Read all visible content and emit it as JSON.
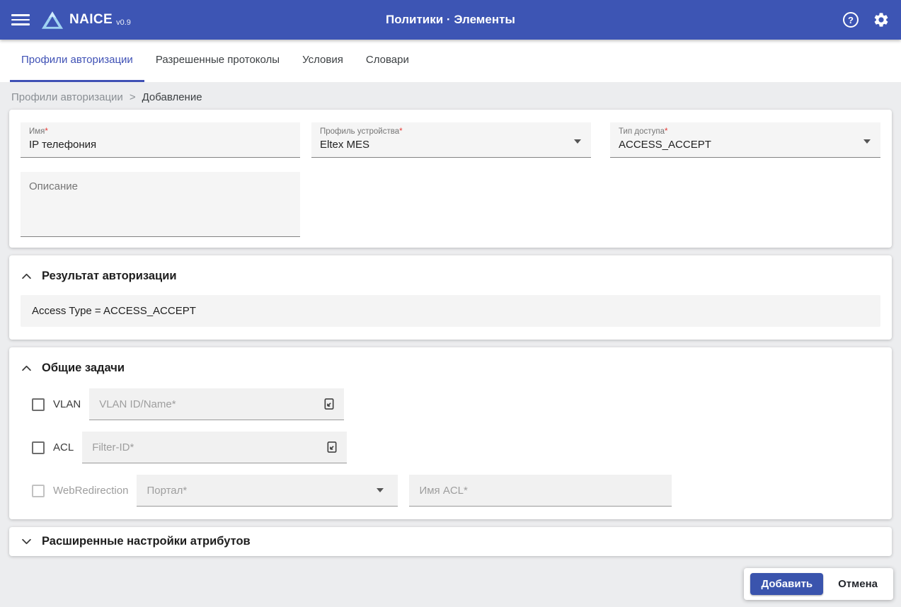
{
  "colors": {
    "app_bar": "#3d55b4",
    "accent": "#3f51b5",
    "required": "#e53935",
    "submit_button": "#3a54ad"
  },
  "app_bar": {
    "brand": "NAICE",
    "version": "v0.9",
    "title": "Политики · Элементы"
  },
  "tabs": [
    {
      "label": "Профили авторизации",
      "active": true
    },
    {
      "label": "Разрешенные протоколы",
      "active": false
    },
    {
      "label": "Условия",
      "active": false
    },
    {
      "label": "Словари",
      "active": false
    }
  ],
  "breadcrumb": {
    "parent": "Профили авторизации",
    "separator": ">",
    "current": "Добавление"
  },
  "form": {
    "name": {
      "label": "Имя",
      "required": "*",
      "value": "IP телефония"
    },
    "device_profile": {
      "label": "Профиль устройства",
      "required": "*",
      "value": "Eltex MES"
    },
    "access_type": {
      "label": "Тип доступа",
      "required": "*",
      "value": "ACCESS_ACCEPT"
    },
    "description": {
      "placeholder": "Описание"
    }
  },
  "authorization_result": {
    "title": "Результат авторизации",
    "value": "Access Type = ACCESS_ACCEPT"
  },
  "common_tasks": {
    "title": "Общие задачи",
    "vlan": {
      "label": "VLAN",
      "placeholder": "VLAN ID/Name*"
    },
    "acl": {
      "label": "ACL",
      "placeholder": "Filter-ID*"
    },
    "web_redirection": {
      "label": "WebRedirection",
      "portal_placeholder": "Портал*",
      "acl_placeholder": "Имя ACL*"
    }
  },
  "advanced_settings": {
    "title": "Расширенные настройки атрибутов"
  },
  "actions": {
    "submit": "Добавить",
    "cancel": "Отмена"
  }
}
